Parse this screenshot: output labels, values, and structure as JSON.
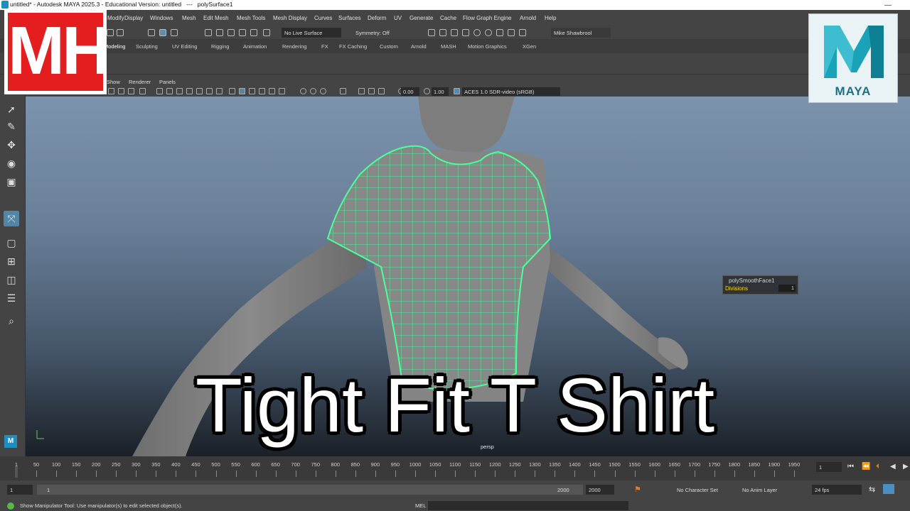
{
  "titlebar": {
    "title": "untitled* - Autodesk MAYA 2025.3 - Educational Version: untitled   ---   polySurface1",
    "minimize": "—"
  },
  "menus": [
    "Modify",
    "Display",
    "Windows",
    "Mesh",
    "Edit Mesh",
    "Mesh Tools",
    "Mesh Display",
    "Curves",
    "Surfaces",
    "Deform",
    "UV",
    "Generate",
    "Cache",
    "Flow Graph Engine",
    "Arnold",
    "Help"
  ],
  "statusline": {
    "live_surface": "No Live Surface",
    "symmetry": "Symmetry: Off",
    "user": "Mike Shawbrool"
  },
  "shelf_tabs": [
    "Modeling",
    "Sculpting",
    "UV Editing",
    "Rigging",
    "Animation",
    "Rendering",
    "FX",
    "FX Caching",
    "Custom",
    "Arnold",
    "MASH",
    "Motion Graphics",
    "XGen"
  ],
  "panel_menus": [
    "Show",
    "Renderer",
    "Panels"
  ],
  "panel_toolbar": {
    "exposure": "0.00",
    "gamma": "1.00",
    "colorspace": "ACES 1.0 SDR-video (sRGB)"
  },
  "viewport": {
    "camera_label": "persp"
  },
  "attr_overlay": {
    "node": "polySmoothFace1",
    "attr": "Divisions",
    "value": "1"
  },
  "timeline": {
    "current_frame": "1",
    "ticks": [
      "1",
      "50",
      "100",
      "150",
      "200",
      "250",
      "300",
      "350",
      "400",
      "450",
      "500",
      "550",
      "600",
      "650",
      "700",
      "750",
      "800",
      "850",
      "900",
      "950",
      "1000",
      "1050",
      "1100",
      "1150",
      "1200",
      "1250",
      "1300",
      "1350",
      "1400",
      "1450",
      "1500",
      "1550",
      "1600",
      "1650",
      "1700",
      "1750",
      "1800",
      "1850",
      "1900",
      "1950"
    ],
    "frame_field": "1"
  },
  "range": {
    "start": "1",
    "inner_start": "1",
    "inner_end": "2000",
    "end": "2000",
    "character_set": "No Character Set",
    "anim_layer": "No Anim Layer",
    "fps": "24 fps"
  },
  "helpline": {
    "text": "Show Manipulator Tool: Use manipulator(s) to edit selected object(s).",
    "mel": "MEL"
  },
  "overlay": {
    "logo_left": "MH",
    "logo_right": "MAYA",
    "headline": "Tight Fit T Shirt"
  },
  "colors": {
    "accent_green": "#4dff9a",
    "brand_red": "#e41e1e",
    "maya_teal": "#1d6f86"
  }
}
